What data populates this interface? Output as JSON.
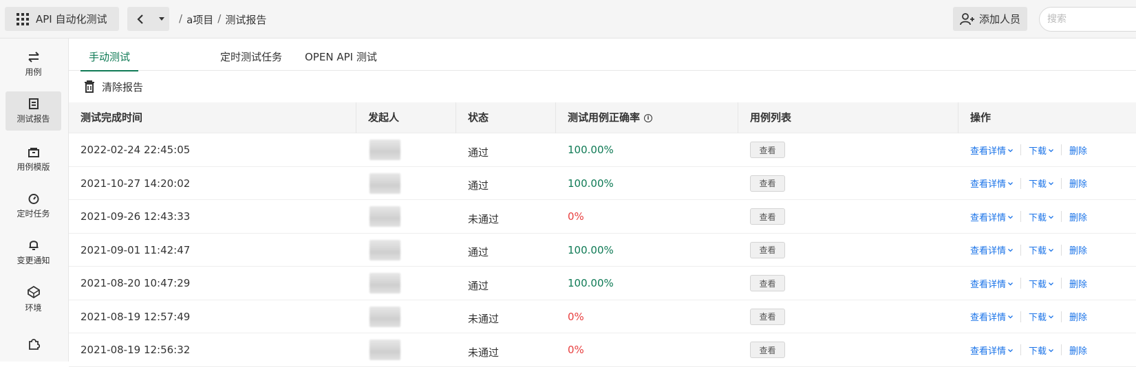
{
  "topbar": {
    "app_title": "API 自动化测试",
    "breadcrumb": [
      "a项目",
      "测试报告"
    ],
    "add_member_label": "添加人员",
    "search_placeholder": "搜索"
  },
  "sidebar": {
    "items": [
      {
        "label": "用例",
        "icon": "swap-arrows-icon",
        "active": false
      },
      {
        "label": "测试报告",
        "icon": "report-icon",
        "active": true
      },
      {
        "label": "用例模版",
        "icon": "template-icon",
        "active": false
      },
      {
        "label": "定时任务",
        "icon": "timer-icon",
        "active": false
      },
      {
        "label": "变更通知",
        "icon": "bell-icon",
        "active": false
      },
      {
        "label": "环境",
        "icon": "environment-icon",
        "active": false
      },
      {
        "label": "",
        "icon": "plugin-icon",
        "active": false
      }
    ]
  },
  "tabs": [
    {
      "label": "手动测试",
      "active": true
    },
    {
      "label": "定时测试任务",
      "active": false
    },
    {
      "label": "OPEN API 测试",
      "active": false
    }
  ],
  "toolbar": {
    "clear_label": "清除报告"
  },
  "table": {
    "headers": [
      "测试完成时间",
      "发起人",
      "状态",
      "测试用例正确率",
      "用例列表",
      "操作"
    ],
    "view_label": "查看",
    "ops": {
      "details": "查看详情",
      "download": "下载",
      "delete": "删除"
    },
    "rows": [
      {
        "time": "2022-02-24 22:45:05",
        "status": "通过",
        "rate": "100.00%",
        "passed": true
      },
      {
        "time": "2021-10-27 14:20:02",
        "status": "通过",
        "rate": "100.00%",
        "passed": true
      },
      {
        "time": "2021-09-26 12:43:33",
        "status": "未通过",
        "rate": "0%",
        "passed": false
      },
      {
        "time": "2021-09-01 11:42:47",
        "status": "通过",
        "rate": "100.00%",
        "passed": true
      },
      {
        "time": "2021-08-20 10:47:29",
        "status": "通过",
        "rate": "100.00%",
        "passed": true
      },
      {
        "time": "2021-08-19 12:57:49",
        "status": "未通过",
        "rate": "0%",
        "passed": false
      },
      {
        "time": "2021-08-19 12:56:32",
        "status": "未通过",
        "rate": "0%",
        "passed": false
      }
    ]
  },
  "colors": {
    "accent": "#0f7a55",
    "fail": "#e84040",
    "link": "#1a73e8"
  }
}
